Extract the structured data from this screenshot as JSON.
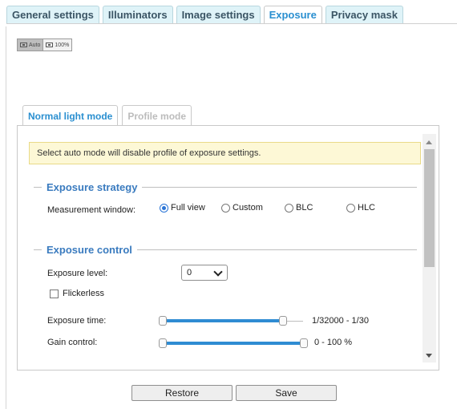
{
  "top_tabs": [
    {
      "label": "General settings"
    },
    {
      "label": "Illuminators"
    },
    {
      "label": "Image settings"
    },
    {
      "label": "Exposure",
      "active": true
    },
    {
      "label": "Privacy mask"
    }
  ],
  "zoom": {
    "auto_label": "Auto",
    "full_label": "100%"
  },
  "mode_tabs": [
    {
      "label": "Normal light mode",
      "active": true
    },
    {
      "label": "Profile mode",
      "disabled": true
    }
  ],
  "notice": "Select auto mode will disable profile of exposure settings.",
  "exposure_strategy": {
    "title": "Exposure strategy",
    "measurement_label": "Measurement window:",
    "options": [
      "Full view",
      "Custom",
      "BLC",
      "HLC"
    ],
    "selected": "Full view"
  },
  "exposure_control": {
    "title": "Exposure control",
    "level_label": "Exposure level:",
    "level_value": "0",
    "flickerless_label": "Flickerless",
    "flickerless_checked": false,
    "exposure_time_label": "Exposure time:",
    "exposure_time_range": "1/32000 - 1/30",
    "gain_label": "Gain control:",
    "gain_range": "0 - 100 %"
  },
  "buttons": {
    "restore": "Restore",
    "save": "Save"
  },
  "colors": {
    "accent": "#2a8fd0",
    "section_title": "#3a7bbf",
    "slider": "#2f8cd3",
    "notice_bg": "#fdf8d6"
  }
}
